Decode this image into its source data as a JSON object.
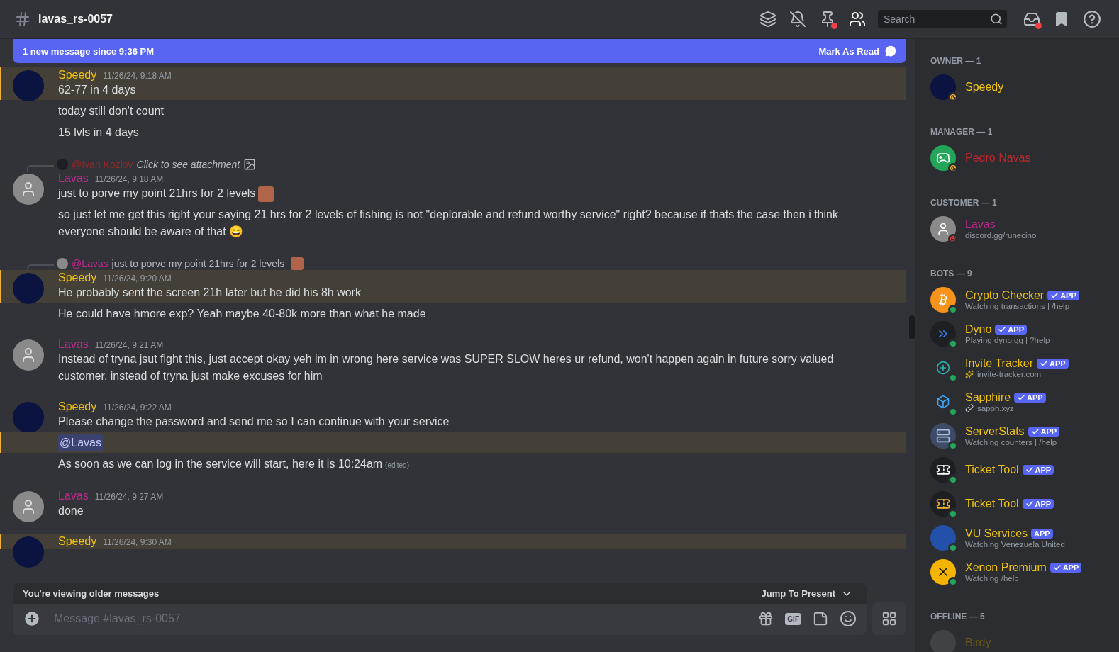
{
  "channel": {
    "name": "lavas_rs-0057"
  },
  "search": {
    "placeholder": "Search"
  },
  "banner": {
    "text": "1 new message since 9:36 PM",
    "action": "Mark As Read"
  },
  "messages": [
    {
      "author": "Speedy",
      "color": "#f0c30e",
      "kind": "space",
      "time": "11/26/24, 9:18 AM",
      "lines": [
        {
          "kind": "text",
          "text": "62-77 in 4 days",
          "mentioned": true
        },
        {
          "kind": "text",
          "text": "today still don't count",
          "mentioned": false
        },
        {
          "kind": "text",
          "text": "15 lvls in 4 days",
          "mentioned": false
        }
      ]
    },
    {
      "author": "Lavas",
      "color": "#c0288f",
      "kind": "hat",
      "time": "11/26/24, 9:18 AM",
      "reply": {
        "mention": "@Ivan Kozlov",
        "color": "#8b2a2a",
        "text": "Click to see attachment",
        "attachment": true,
        "custom_emoji": false
      },
      "lines": [
        {
          "kind": "text",
          "text": "just to porve my point 21hrs for 2 levels",
          "custom_emoji": true,
          "mentioned": false
        },
        {
          "kind": "text",
          "text": "so just let me get this right your saying 21 hrs for 2 levels of fishing is not \"deplorable and refund worthy service\" right? because if thats the case then i think everyone should be aware of that 😄",
          "mentioned": false
        }
      ]
    },
    {
      "author": "Speedy",
      "color": "#f0c30e",
      "kind": "space",
      "time": "11/26/24, 9:20 AM",
      "reply": {
        "mention": "@Lavas",
        "color": "#c0288f",
        "text": "just to porve my point 21hrs for 2 levels",
        "attachment": false,
        "custom_emoji": true
      },
      "lines": [
        {
          "kind": "text",
          "text": "He probably sent the screen 21h later but he did his 8h work",
          "mentioned": true
        },
        {
          "kind": "text",
          "text": "He could have hmore exp? Yeah maybe 40-80k more than what he made",
          "mentioned": false
        }
      ]
    },
    {
      "author": "Lavas",
      "color": "#c0288f",
      "kind": "hat",
      "time": "11/26/24, 9:21 AM",
      "lines": [
        {
          "kind": "text",
          "text": "Instead of tryna jsut fight this, just accept okay yeh im in wrong here service was SUPER SLOW heres ur refund, won't happen again in future sorry valued customer, instead of tryna just make excuses for him",
          "mentioned": false
        }
      ]
    },
    {
      "author": "Speedy",
      "color": "#f0c30e",
      "kind": "space",
      "time": "11/26/24, 9:22 AM",
      "lines": [
        {
          "kind": "text",
          "text": "Please change the password and send me so I can continue with your service",
          "mentioned": false
        },
        {
          "kind": "mention",
          "text": "@Lavas",
          "mentioned": true
        },
        {
          "kind": "text",
          "text": "As soon as we can log in the service will start, here it is 10:24am",
          "edited": "(edited)",
          "mentioned": false
        }
      ]
    },
    {
      "author": "Lavas",
      "color": "#c0288f",
      "kind": "hat",
      "time": "11/26/24, 9:27 AM",
      "lines": [
        {
          "kind": "text",
          "text": "done",
          "mentioned": false
        }
      ]
    },
    {
      "author": "Speedy",
      "color": "#f0c30e",
      "kind": "space",
      "time": "11/26/24, 9:30 AM",
      "mentioned_header": true
    }
  ],
  "older_bar": {
    "text": "You're viewing older messages",
    "action": "Jump To Present"
  },
  "composer": {
    "placeholder": "Message #lavas_rs-0057",
    "gif": "GIF"
  },
  "member_sections": [
    {
      "title": "OWNER — 1",
      "members": [
        {
          "name": "Speedy",
          "color": "#f0c30e",
          "kind": "space",
          "status": {
            "kind": "idle"
          }
        }
      ]
    },
    {
      "title": "MANAGER — 1",
      "members": [
        {
          "name": "Pedro Navas",
          "color": "#c0262c",
          "kind": "controller",
          "status": {
            "kind": "idle"
          }
        }
      ]
    },
    {
      "title": "CUSTOMER — 1",
      "members": [
        {
          "name": "Lavas",
          "color": "#c0288f",
          "kind": "hat",
          "status": {
            "kind": "dnd"
          },
          "activity": "discord.gg/runecino"
        }
      ]
    },
    {
      "title": "BOTS — 9",
      "members": [
        {
          "name": "Crypto Checker",
          "color": "#f0c30e",
          "kind": "bitcoin",
          "status": {
            "kind": "online"
          },
          "badge": "APP",
          "verified": true,
          "activity": "Watching transactions | /help"
        },
        {
          "name": "Dyno",
          "color": "#f0c30e",
          "kind": "diamond",
          "status": {
            "kind": "online"
          },
          "badge": "APP",
          "verified": true,
          "activity": "Playing dyno.gg | ?help"
        },
        {
          "name": "Invite Tracker",
          "color": "#f0c30e",
          "kind": "plus",
          "status": {
            "kind": "online"
          },
          "badge": "APP",
          "verified": true,
          "activity": "invite-tracker.com",
          "activity_icon": {
            "kind": "sparkles"
          }
        },
        {
          "name": "Sapphire",
          "color": "#f0c30e",
          "kind": "cube",
          "status": {
            "kind": "online"
          },
          "badge": "APP",
          "verified": true,
          "activity": "sapph.xyz",
          "activity_icon": {
            "kind": "link"
          }
        },
        {
          "name": "ServerStats",
          "color": "#f0c30e",
          "kind": "server",
          "status": {
            "kind": "online"
          },
          "badge": "APP",
          "verified": true,
          "activity": "Watching counters | /help"
        },
        {
          "name": "Ticket Tool",
          "color": "#f0c30e",
          "kind": "ticket",
          "status": {
            "kind": "online"
          },
          "badge": "APP",
          "verified": true
        },
        {
          "name": "Ticket Tool",
          "color": "#f0c30e",
          "kind": "goldticket",
          "status": {
            "kind": "online"
          },
          "badge": "APP",
          "verified": true
        },
        {
          "name": "VU Services",
          "color": "#f0c30e",
          "kind": "flag",
          "status": {
            "kind": "online"
          },
          "badge": "APP",
          "verified": false,
          "activity": "Watching Venezuela United"
        },
        {
          "name": "Xenon Premium",
          "color": "#f0c30e",
          "kind": "xenon",
          "status": {
            "kind": "online"
          },
          "badge": "APP",
          "verified": true,
          "activity": "Watching /help"
        }
      ]
    },
    {
      "title": "OFFLINE — 5",
      "members": [
        {
          "name": "Birdy",
          "color": "#6b5a1c",
          "kind": "bird"
        }
      ]
    }
  ]
}
